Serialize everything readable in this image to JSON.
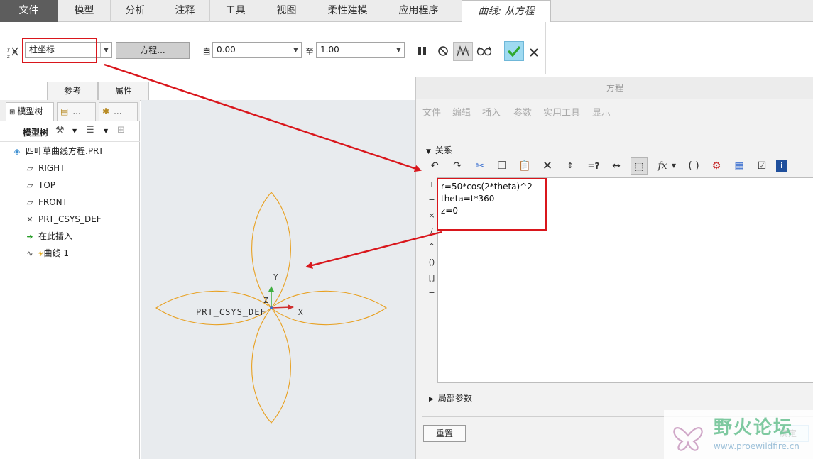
{
  "ribbon_tabs": [
    "文件",
    "模型",
    "分析",
    "注释",
    "工具",
    "视图",
    "柔性建模",
    "应用程序",
    "曲线: 从方程"
  ],
  "ribbon": {
    "coord_type": "柱坐标",
    "equation_button": "方程...",
    "from_label": "自",
    "from_value": "0.00",
    "to_label": "至",
    "to_value": "1.00",
    "subtabs": [
      "参考",
      "属性"
    ]
  },
  "tree": {
    "tabs": [
      "模型树",
      "...",
      "..."
    ],
    "toolbar_label": "模型树",
    "items": [
      "四叶草曲线方程.PRT",
      "RIGHT",
      "TOP",
      "FRONT",
      "PRT_CSYS_DEF",
      "在此插入",
      "曲线 1"
    ]
  },
  "canvas": {
    "csys_label": "PRT_CSYS_DEF",
    "axis_x": "X",
    "axis_y": "Y",
    "axis_z": "Z"
  },
  "dialog": {
    "title": "方程",
    "menu": [
      "文件",
      "编辑",
      "插入",
      "参数",
      "实用工具",
      "显示"
    ],
    "relations_label": "关系",
    "operators": [
      "+",
      "−",
      "×",
      "/",
      "^",
      "()",
      "[]",
      "="
    ],
    "equations": [
      "r=50*cos(2*theta)^2",
      "theta=t*360",
      "z=0"
    ],
    "local_params_label": "局部参数",
    "reset_button": "重置",
    "ok_button": "确定"
  },
  "watermark": {
    "text": "野火论坛",
    "url": "www.proewildfire.cn"
  },
  "colors": {
    "accent_red": "#d9161c",
    "curve_orange": "#e8a020",
    "confirm_green": "#2fa830"
  }
}
